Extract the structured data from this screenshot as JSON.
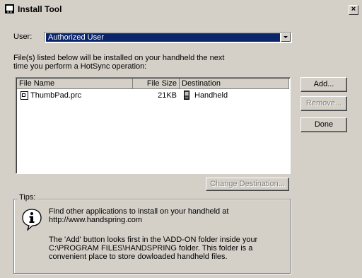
{
  "window": {
    "title": "Install Tool",
    "close_glyph": "×"
  },
  "user": {
    "label": "User:",
    "selected": "Authorized User"
  },
  "instructions": {
    "line1": "File(s) listed below will be installed on your handheld the next",
    "line2": "time you perform a HotSync operation:"
  },
  "file_list": {
    "columns": [
      "File Name",
      "File Size",
      "Destination"
    ],
    "rows": [
      {
        "name": "ThumbPad.prc",
        "size": "21KB",
        "destination": "Handheld"
      }
    ]
  },
  "buttons": {
    "add": "Add...",
    "remove": "Remove...",
    "done": "Done",
    "change_destination": "Change Destination..."
  },
  "tips": {
    "caption": "Tips:",
    "line1": "Find other applications to install on your handheld at",
    "line2": "http://www.handspring.com",
    "line3": "The 'Add' button looks first in the \\ADD-ON folder inside your",
    "line4": "C:\\PROGRAM FILES\\HANDSPRING folder. This folder is a",
    "line5": "convenient place to store dowloaded handheld files."
  },
  "icons": {
    "app": "install-tool-icon",
    "file": "prc-file-icon",
    "device": "handheld-icon",
    "tips": "info-icon"
  }
}
